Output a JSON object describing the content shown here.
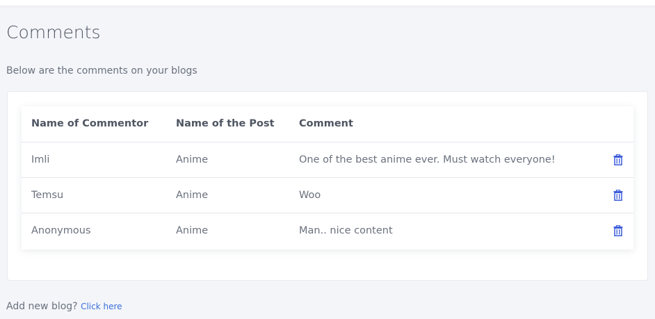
{
  "page": {
    "title": "Comments",
    "subtitle": "Below are the comments on your blogs"
  },
  "table": {
    "headers": [
      "Name of Commentor",
      "Name of the Post",
      "Comment"
    ],
    "rows": [
      {
        "commentor": "Imli",
        "post": "Anime",
        "comment": "One of the best anime ever. Must watch everyone!"
      },
      {
        "commentor": "Temsu",
        "post": "Anime",
        "comment": "Woo"
      },
      {
        "commentor": "Anonymous",
        "post": "Anime",
        "comment": "Man.. nice content"
      }
    ],
    "delete_icon": "trash-icon"
  },
  "footer": {
    "prompt": "Add new blog?",
    "link_label": "Click here"
  },
  "colors": {
    "accent": "#3a6fd8",
    "icon": "#3b5bdb",
    "background": "#f3f5f9"
  }
}
